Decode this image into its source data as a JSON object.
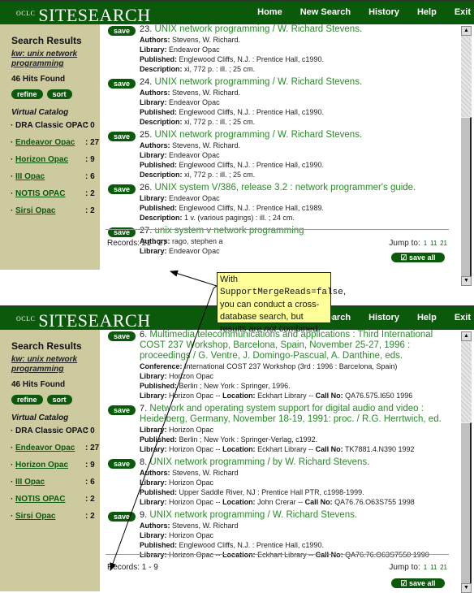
{
  "app": {
    "logo_prefix": "OCLC",
    "logo_name": "SITESEARCH",
    "nav": [
      "Home",
      "New Search",
      "History",
      "Help",
      "Exit"
    ]
  },
  "sidebar": {
    "title": "Search Results",
    "query": "kw: unix network programming",
    "hits": "46 Hits Found",
    "refine_label": "refine",
    "sort_label": "sort",
    "virtual_catalog_label": "Virtual Catalog",
    "catalogs": [
      {
        "name": "DRA Classic OPAC",
        "count": ": 0",
        "link": false
      },
      {
        "name": "Endeavor Opac",
        "count": ": 27",
        "link": true
      },
      {
        "name": "Horizon Opac",
        "count": ": 9",
        "link": true
      },
      {
        "name": "III Opac",
        "count": ": 6",
        "link": true
      },
      {
        "name": "NOTIS OPAC",
        "count": ": 2",
        "link": true
      },
      {
        "name": "Sirsi Opac",
        "count": ": 2",
        "link": true
      }
    ]
  },
  "screen1": {
    "records": [
      {
        "num": "23.",
        "title": "UNIX network programming / W. Richard Stevens.",
        "fields": [
          [
            "Authors:",
            "Stevens, W. Richard."
          ],
          [
            "Library:",
            "Endeavor Opac"
          ],
          [
            "Published:",
            "Englewood Cliffs, N.J. : Prentice Hall, c1990."
          ],
          [
            "Description:",
            "xi, 772 p. : ill. ; 25 cm."
          ]
        ]
      },
      {
        "num": "24.",
        "title": "UNIX network programming / W. Richard Stevens.",
        "fields": [
          [
            "Authors:",
            "Stevens, W. Richard."
          ],
          [
            "Library:",
            "Endeavor Opac"
          ],
          [
            "Published:",
            "Englewood Cliffs, N.J. : Prentice Hall, c1990."
          ],
          [
            "Description:",
            "xi, 772 p. : ill. ; 25 cm."
          ]
        ]
      },
      {
        "num": "25.",
        "title": "UNIX network programming / W. Richard Stevens.",
        "fields": [
          [
            "Authors:",
            "Stevens, W. Richard."
          ],
          [
            "Library:",
            "Endeavor Opac"
          ],
          [
            "Published:",
            "Englewood Cliffs, N.J. : Prentice Hall, c1990."
          ],
          [
            "Description:",
            "xi, 772 p. : ill. ; 25 cm."
          ]
        ]
      },
      {
        "num": "26.",
        "title": "UNIX system V/386, release 3.2 : network programmer's guide.",
        "fields": [
          [
            "Library:",
            "Endeavor Opac"
          ],
          [
            "Published:",
            "Englewood Cliffs, N.J. : Prentice Hall, c1989."
          ],
          [
            "Description:",
            "1 v. (various pagings) : ill. ; 24 cm."
          ]
        ]
      },
      {
        "num": "27.",
        "title": "unix system v network programming",
        "fields": [
          [
            "Authors:",
            "rago, stephen a"
          ],
          [
            "Library:",
            "Endeavor Opac"
          ]
        ]
      }
    ],
    "records_label": "Records: 21 - 27"
  },
  "screen2": {
    "records": [
      {
        "num": "6.",
        "title": "Multimedia telecommunications and applications : Third International COST 237 Workshop, Barcelona, Spain, November 25-27, 1996 : proceedings / G. Ventre, J. Domingo-Pascual, A. Danthine, eds.",
        "fields": [
          [
            "Conference:",
            "International COST 237 Workshop (3rd : 1996 : Barcelona, Spain)"
          ],
          [
            "Library:",
            "Horizon Opac"
          ],
          [
            "Published:",
            "Berlin ; New York : Springer, 1996."
          ],
          [
            "Library:",
            "Horizon Opac -- ",
            "Location:",
            "Eckhart Library -- ",
            "Call No:",
            "QA76.575.I650 1996"
          ]
        ]
      },
      {
        "num": "7.",
        "title": "Network and operating system support for digital audio and video : Heidelberg, Germany, November 18-19, 1991: proc. / R.G. Herrtwich, ed.",
        "fields": [
          [
            "Library:",
            "Horizon Opac"
          ],
          [
            "Published:",
            "Berlin ; New York : Springer-Verlag, c1992."
          ],
          [
            "Library:",
            "Horizon Opac -- ",
            "Location:",
            "Eckhart Library -- ",
            "Call No:",
            "TK7881.4.N390 1992"
          ]
        ]
      },
      {
        "num": "8.",
        "title": "UNIX network programming / by W. Richard Stevens.",
        "fields": [
          [
            "Authors:",
            "Stevens, W. Richard"
          ],
          [
            "Library:",
            "Horizon Opac"
          ],
          [
            "Published:",
            "Upper Saddle River, NJ : Prentice Hall PTR, c1998-1999."
          ],
          [
            "Library:",
            "Horizon Opac -- ",
            "Location:",
            "John Crerar -- ",
            "Call No:",
            "QA76.76.O63S755 1998"
          ]
        ]
      },
      {
        "num": "9.",
        "title": "UNIX network programming / W. Richard Stevens.",
        "fields": [
          [
            "Authors:",
            "Stevens, W. Richard"
          ],
          [
            "Library:",
            "Horizon Opac"
          ],
          [
            "Published:",
            "Englewood Cliffs, N.J. : Prentice Hall, c1990."
          ],
          [
            "Library:",
            "Horizon Opac -- ",
            "Location:",
            "Eckhart Library -- ",
            "Call No:",
            "QA76.76.O63S7550 1990"
          ]
        ]
      }
    ],
    "records_label": "Records: 1 - 9"
  },
  "footer": {
    "jump_label": "Jump to:",
    "pages": [
      "1",
      "11",
      "21"
    ],
    "save_all_label": "save all",
    "save_label": "save"
  },
  "callout": {
    "prefix": "With ",
    "code": "SupportMergeReads=false",
    "middle": ", you can conduct a cross-database search, but results are ",
    "emph": "not",
    "suffix": " combined."
  },
  "colors": {
    "brand_green": "#0b5a0b",
    "title_green": "#2a8a2a",
    "sidebar_bg": "#cdcaa0",
    "callout_bg": "#ffff99"
  }
}
